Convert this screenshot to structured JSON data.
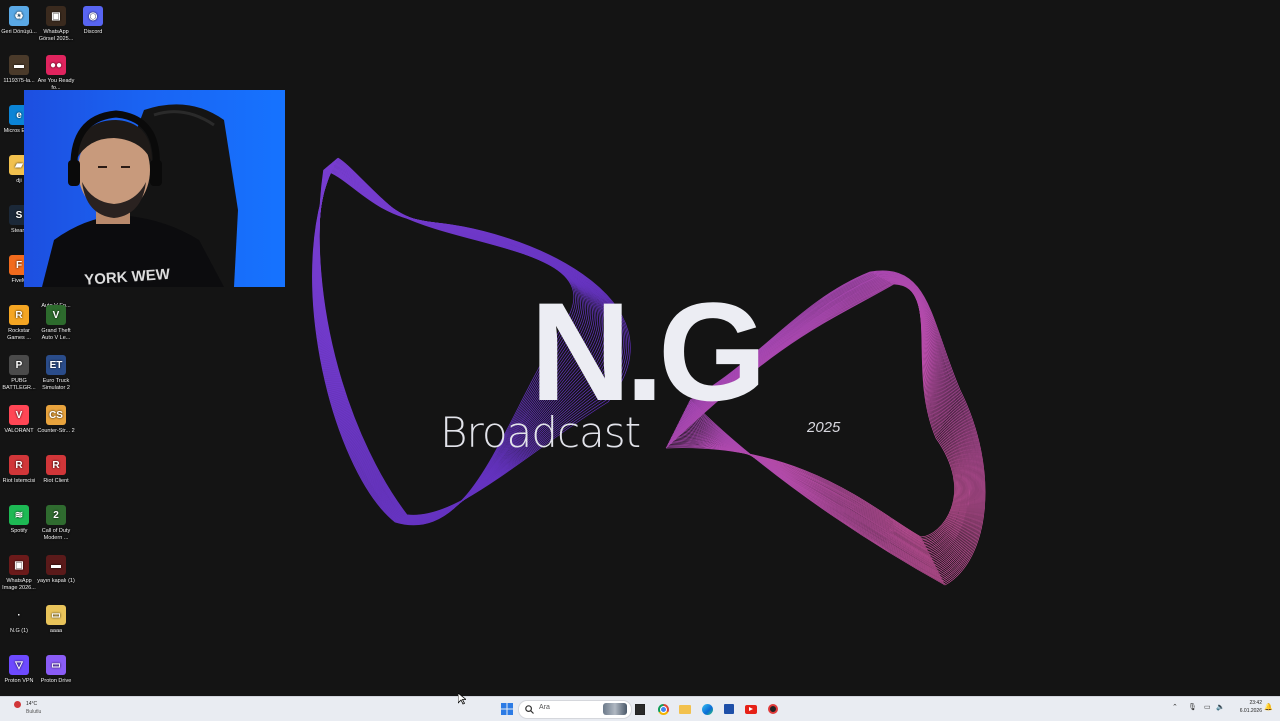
{
  "wallpaper": {
    "brand": "N.G",
    "subtitle": "Broadcast",
    "year": "2025",
    "wave_colors": [
      "#7a3ff0",
      "#c24bd6",
      "#e95ab4"
    ]
  },
  "desktop_icons": [
    {
      "id": "recycle-bin",
      "label": "Geri Dönüşü...",
      "glyph": "♻",
      "color": "#5aa9e6"
    },
    {
      "id": "whatsapp-gorsel",
      "label": "WhatsApp Görsel 2025...",
      "glyph": "▣",
      "color": "#3a2a1e"
    },
    {
      "id": "discord",
      "label": "Discord",
      "glyph": "◉",
      "color": "#5865f2"
    },
    {
      "id": "file-1119375",
      "label": "1119375-la...",
      "glyph": "▬",
      "color": "#4a3a2a"
    },
    {
      "id": "are-you-ready",
      "label": "Are You Ready fo...",
      "glyph": "●●",
      "color": "#e0245e"
    },
    {
      "id": "edge",
      "label": "Micros Edge",
      "glyph": "e",
      "color": "#0b84d6"
    },
    {
      "id": "dji",
      "label": "dji",
      "glyph": "▰",
      "color": "#f2c14e"
    },
    {
      "id": "steam",
      "label": "Steam",
      "glyph": "S",
      "color": "#1b2838"
    },
    {
      "id": "fivem",
      "label": "FiveM",
      "glyph": "F",
      "color": "#f26b1d"
    },
    {
      "id": "gta-auto",
      "label": "Auto V En...",
      "glyph": "",
      "color": "transparent"
    },
    {
      "id": "rockstar",
      "label": "Rockstar Games ...",
      "glyph": "R",
      "color": "#f5a623"
    },
    {
      "id": "gta-v",
      "label": "Grand Theft Auto V Le...",
      "glyph": "V",
      "color": "#2d6b2d"
    },
    {
      "id": "pubg",
      "label": "PUBG BATTLEGR...",
      "glyph": "P",
      "color": "#4a4a4a"
    },
    {
      "id": "euro-truck",
      "label": "Euro Truck Simulator 2",
      "glyph": "ET",
      "color": "#2a4c8a"
    },
    {
      "id": "valorant",
      "label": "VALORANT",
      "glyph": "V",
      "color": "#ff4655"
    },
    {
      "id": "counter-strike",
      "label": "Counter-Str... 2",
      "glyph": "CS",
      "color": "#e8a33d"
    },
    {
      "id": "riot-istemcisi",
      "label": "Riot İstemcisi",
      "glyph": "R",
      "color": "#d13639"
    },
    {
      "id": "riot-client",
      "label": "Riot Client",
      "glyph": "R",
      "color": "#d13639"
    },
    {
      "id": "spotify",
      "label": "Spotify",
      "glyph": "≋",
      "color": "#1db954"
    },
    {
      "id": "call-of-duty",
      "label": "Call of Duty Modern ...",
      "glyph": "2",
      "color": "#2f6b2f"
    },
    {
      "id": "whatsapp-image",
      "label": "WhatsApp Image 2026...",
      "glyph": "▣",
      "color": "#6b1a1a"
    },
    {
      "id": "yayin-kapali",
      "label": "yayın kapalı (1)",
      "glyph": "▬",
      "color": "#5a1a1a"
    },
    {
      "id": "ng-1",
      "label": "N.G (1)",
      "glyph": "·",
      "color": "transparent"
    },
    {
      "id": "folder-aaaa",
      "label": "aaaa",
      "glyph": "▭",
      "color": "#e8c35a"
    },
    {
      "id": "proton-vpn",
      "label": "Proton VPN",
      "glyph": "▽",
      "color": "#6d4aff"
    },
    {
      "id": "proton-drive",
      "label": "Proton Drive",
      "glyph": "▭",
      "color": "#8a5cf6"
    }
  ],
  "taskbar": {
    "weather_temp": "14°C",
    "weather_condition": "Bulutlu",
    "search_placeholder": "Ara",
    "time": "23:42",
    "date": "6.01.2026",
    "pinned": [
      "start",
      "search",
      "task-view",
      "file-explorer-alt",
      "chrome",
      "file-explorer",
      "edge",
      "store",
      "youtube",
      "game-app"
    ]
  }
}
